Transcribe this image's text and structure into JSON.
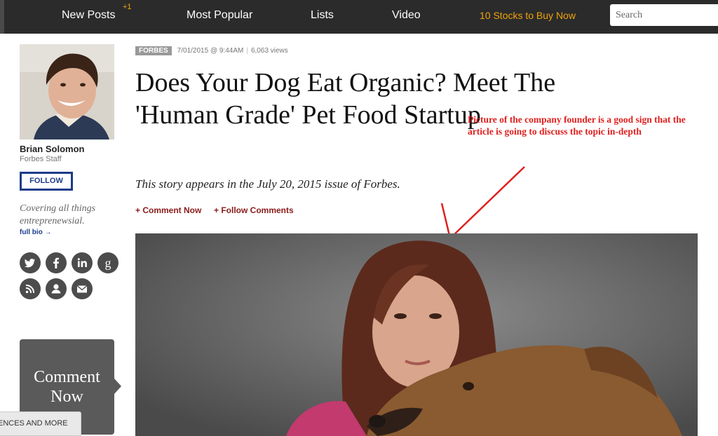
{
  "nav": {
    "items": [
      "New Posts",
      "Most Popular",
      "Lists",
      "Video"
    ],
    "new_posts_badge": "+1",
    "promo": "10 Stocks to Buy Now",
    "search_placeholder": "Search",
    "promo_color": "#f0a30a"
  },
  "author": {
    "name": "Brian Solomon",
    "role": "Forbes Staff",
    "follow_label": "FOLLOW",
    "tagline": "Covering all things entreprenewsial.",
    "full_bio_label": "full bio →",
    "social_icons": [
      "twitter-icon",
      "facebook-icon",
      "linkedin-icon",
      "google-plus-icon",
      "rss-icon",
      "profile-icon",
      "email-icon"
    ]
  },
  "article": {
    "source": "FORBES",
    "date": "7/01/2015 @ 9:44AM",
    "views": "6,063 views",
    "headline": "Does Your Dog Eat Organic? Meet The 'Human Grade' Pet Food Startup",
    "dek": "This story appears in the July 20, 2015 issue of Forbes.",
    "comment_now_link": "+ Comment Now",
    "follow_comments_link": "+ Follow Comments"
  },
  "sidebar_comment": "Comment Now",
  "preferences_tab": "ENCES AND MORE",
  "annotation": {
    "text": "Picture of the company founder is a good sign that the article is going to discuss the topic in-depth",
    "color": "#e0201e"
  }
}
